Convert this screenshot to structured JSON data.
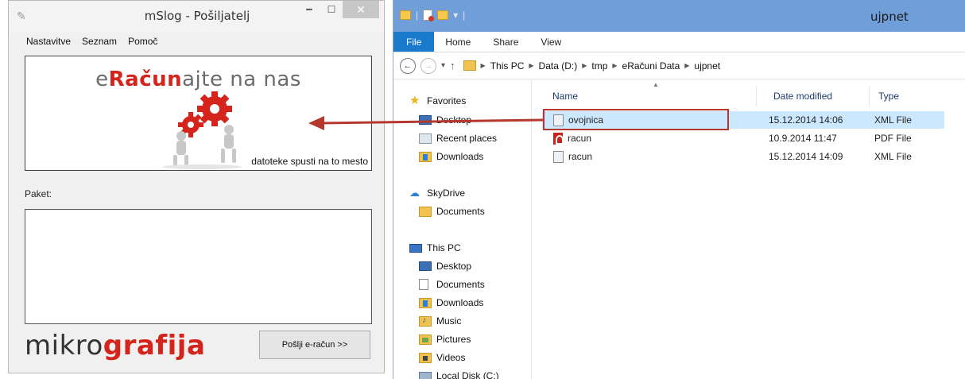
{
  "mslog": {
    "title": "mSlog - Pošiljatelj",
    "menu": [
      "Nastavitve",
      "Seznam",
      "Pomoč"
    ],
    "banner_pre": "e",
    "banner_red": "Račun",
    "banner_post": "ajte na nas",
    "drop_hint": "datoteke spusti na to mesto",
    "paket_label": "Paket:",
    "brand_left": "mikro",
    "brand_right": "grafija",
    "send_button": "Pošlji e-račun >>",
    "accent_red": "#d5241c"
  },
  "explorer": {
    "title": "ujpnet",
    "ribbon_tabs": [
      "File",
      "Home",
      "Share",
      "View"
    ],
    "breadcrumb": [
      "This PC",
      "Data (D:)",
      "tmp",
      "eRačuni Data",
      "ujpnet"
    ],
    "nav": {
      "favorites": "Favorites",
      "fav_items": [
        "Desktop",
        "Recent places",
        "Downloads"
      ],
      "skydrive": "SkyDrive",
      "sky_items": [
        "Documents"
      ],
      "thispc": "This PC",
      "pc_items": [
        "Desktop",
        "Documents",
        "Downloads",
        "Music",
        "Pictures",
        "Videos",
        "Local Disk (C:)"
      ]
    },
    "columns": [
      "Name",
      "Date modified",
      "Type"
    ],
    "files": [
      {
        "name": "ovojnica",
        "date": "15.12.2014 14:06",
        "type": "XML File",
        "icon": "xml-file-icon",
        "selected": true
      },
      {
        "name": "racun",
        "date": "10.9.2014 11:47",
        "type": "PDF File",
        "icon": "pdf-file-icon",
        "selected": false
      },
      {
        "name": "racun",
        "date": "15.12.2014 14:09",
        "type": "XML File",
        "icon": "xml-file-icon",
        "selected": false
      }
    ],
    "title_bar_color": "#6f9ed8",
    "file_tab_color": "#1979ca",
    "selection_color": "#cce8ff",
    "highlight_color": "#b5382d"
  }
}
